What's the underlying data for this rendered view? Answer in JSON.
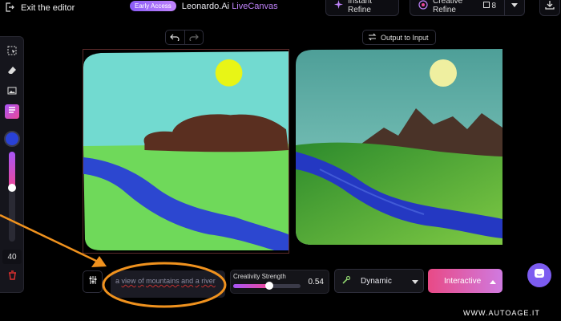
{
  "header": {
    "exit_label": "Exit the editor",
    "badge": "Early Access",
    "app_name": "Leonardo.Ai",
    "app_mode": "LiveCanvas",
    "instant_refine": "Instant Refine",
    "creative_refine": "Creative Refine",
    "creative_count": "8"
  },
  "canvas_controls": {
    "output_to_input": "Output to Input"
  },
  "toolbar": {
    "brush_size": "40",
    "brush_color": "#2941d6",
    "brush_size_level": 0.6
  },
  "bottom": {
    "prompt_words": [
      "a",
      "view",
      "of",
      "mountains",
      "and",
      "a",
      "river"
    ],
    "creativity_label": "Creativity Strength",
    "creativity_value": "0.54",
    "creativity_level": 0.54,
    "style_value": "Dynamic",
    "mode_button": "Interactive"
  },
  "watermark": "WWW.AUTOAGE.IT",
  "colors": {
    "accent_start": "#a855f7",
    "accent_end": "#ec4899",
    "annotation": "#f0921e"
  }
}
